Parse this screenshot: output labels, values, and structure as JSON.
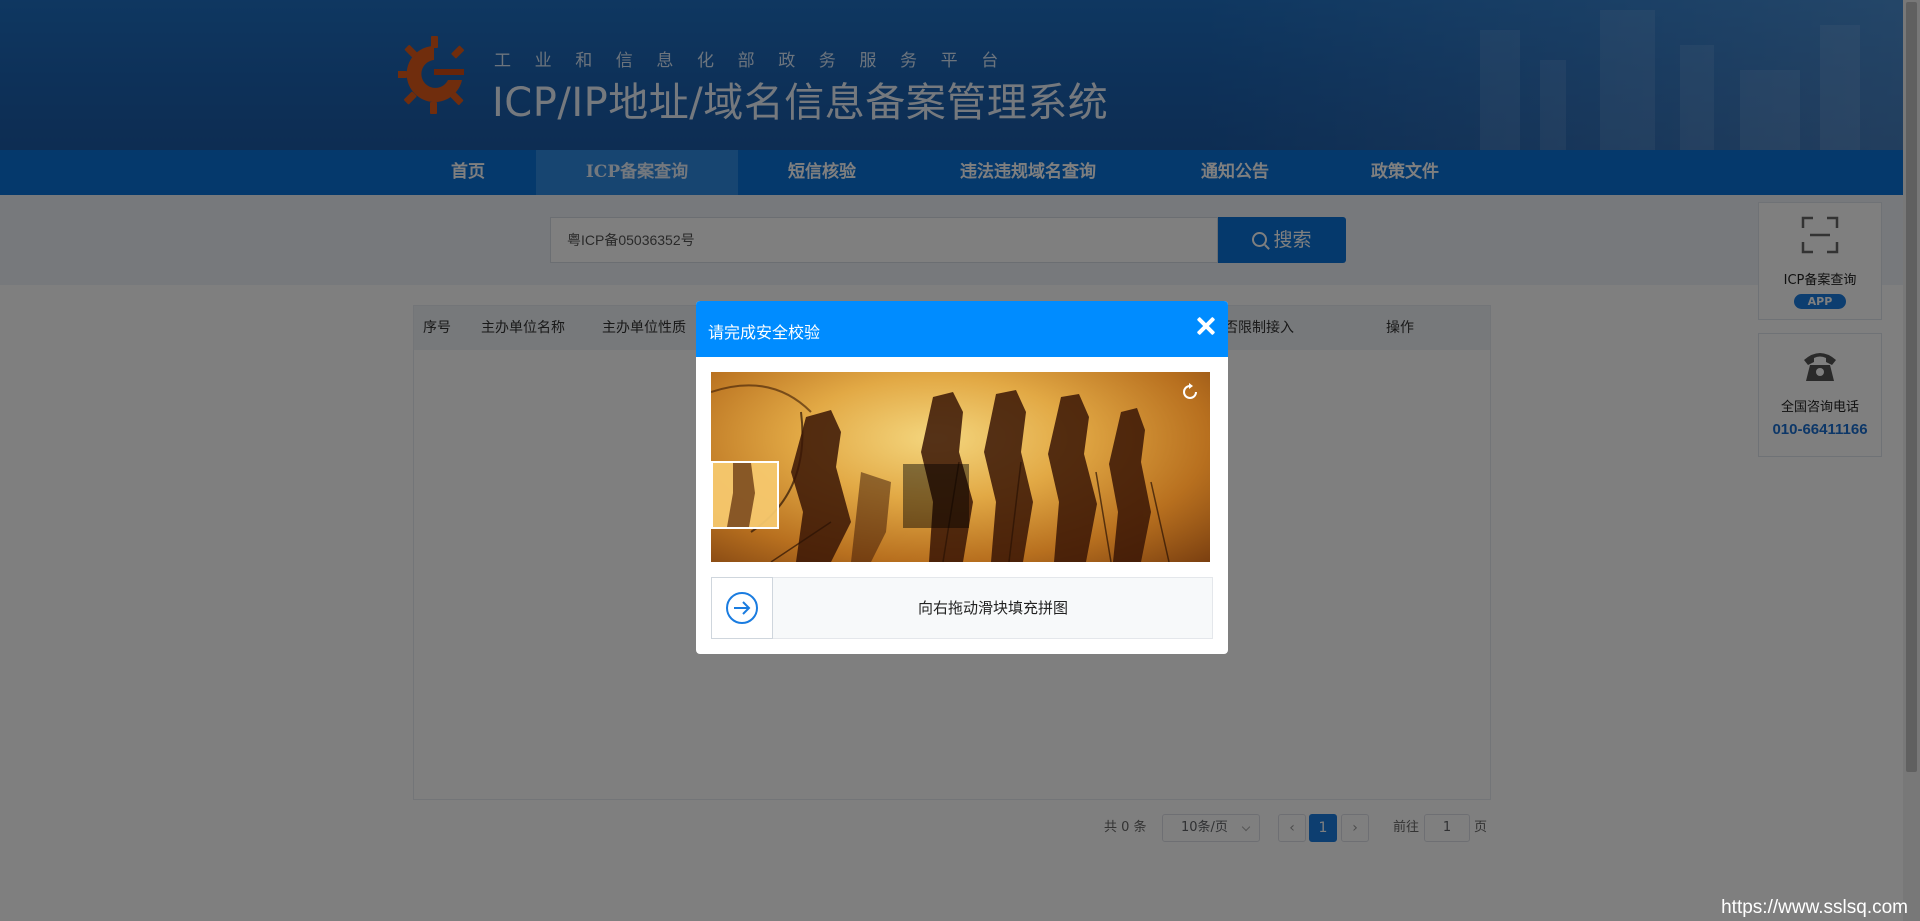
{
  "header": {
    "tagline": "工业和信息化部政务服务平台",
    "title": "ICP/IP地址/域名信息备案管理系统"
  },
  "nav": {
    "items": [
      {
        "label": "首页"
      },
      {
        "label": "ICP备案查询",
        "active": true
      },
      {
        "label": "短信核验"
      },
      {
        "label": "违法违规域名查询"
      },
      {
        "label": "通知公告"
      },
      {
        "label": "政策文件"
      }
    ]
  },
  "search": {
    "value": "粤ICP备05036352号",
    "button_label": "搜索"
  },
  "table": {
    "columns": [
      "序号",
      "主办单位名称",
      "主办单位性质",
      "否限制接入",
      "操作"
    ]
  },
  "pagination": {
    "total": "共 0 条",
    "page_size": "10条/页",
    "current_page": "1",
    "goto_label": "前往",
    "goto_value": "1",
    "page_suffix": "页"
  },
  "widgets": {
    "app_label": "ICP备案查询",
    "app_badge": "APP",
    "hotline_label": "全国咨询电话",
    "hotline_number": "010-66411166"
  },
  "captcha": {
    "title": "请完成安全校验",
    "slider_hint": "向右拖动滑块填充拼图"
  },
  "watermark": "https://www.sslsq.com",
  "colors": {
    "nav_blue": "#0a72d8",
    "dialog_head": "#008cff",
    "pager_active": "#1a7ce0"
  }
}
